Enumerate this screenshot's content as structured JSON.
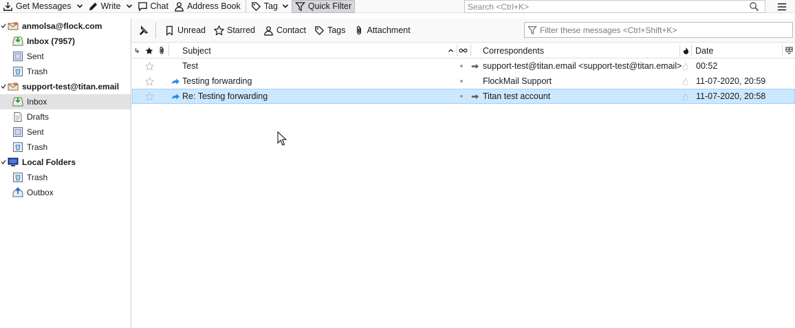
{
  "toolbar": {
    "get_messages": "Get Messages",
    "write": "Write",
    "chat": "Chat",
    "address_book": "Address Book",
    "tag": "Tag",
    "quick_filter": "Quick Filter",
    "search_placeholder": "Search <Ctrl+K>"
  },
  "folders": {
    "account1": {
      "name": "anmolsa@flock.com",
      "inbox": "Inbox (7957)",
      "sent": "Sent",
      "trash": "Trash"
    },
    "account2": {
      "name": "support-test@titan.email",
      "inbox": "Inbox",
      "drafts": "Drafts",
      "sent": "Sent",
      "trash": "Trash"
    },
    "local": {
      "name": "Local Folders",
      "trash": "Trash",
      "outbox": "Outbox"
    }
  },
  "quick_filter": {
    "unread": "Unread",
    "starred": "Starred",
    "contact": "Contact",
    "tags": "Tags",
    "attachment": "Attachment",
    "filter_placeholder": "Filter these messages <Ctrl+Shift+K>"
  },
  "columns": {
    "subject": "Subject",
    "correspondents": "Correspondents",
    "date": "Date"
  },
  "messages": [
    {
      "subject": "Test",
      "correspondent": "support-test@titan.email <support-test@titan.email>",
      "date": "00:52"
    },
    {
      "subject": "Testing forwarding",
      "correspondent": "FlockMail Support",
      "date": "11-07-2020, 20:59"
    },
    {
      "subject": "Re: Testing forwarding",
      "correspondent": "Titan test account",
      "date": "11-07-2020, 20:58"
    }
  ],
  "colors": {
    "selection": "#cce8ff",
    "selection_border": "#99d1ff",
    "forward_arrow": "#2a8ae6",
    "folder_selected": "#e2e2e5"
  }
}
